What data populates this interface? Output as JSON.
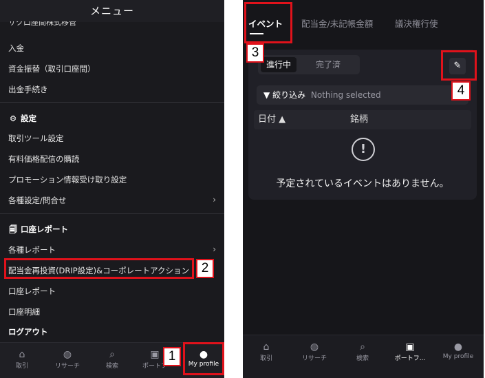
{
  "left": {
    "header_title": "メニュー",
    "cut_row": "サク口座間株式移管",
    "items": [
      {
        "label": "入金"
      },
      {
        "label": "資金振替（取引口座間）"
      },
      {
        "label": "出金手続き"
      }
    ],
    "settings_section": "設定",
    "settings_icon": "gear-icon",
    "settings_items": [
      {
        "label": "取引ツール設定"
      },
      {
        "label": "有料価格配信の購読"
      },
      {
        "label": "プロモーション情報受け取り設定"
      },
      {
        "label": "各種設定/問合せ",
        "chevron": "›"
      }
    ],
    "report_section": "口座レポート",
    "report_icon": "document-icon",
    "report_items": [
      {
        "label": "各種レポート",
        "chevron": "›"
      },
      {
        "label": "配当金再投資(DRIP設定)&コーポレートアクション"
      },
      {
        "label": "口座レポート"
      },
      {
        "label": "口座明細"
      }
    ],
    "logout": "ログアウト",
    "tabbar": [
      {
        "label": "取引",
        "icon": "house-icon"
      },
      {
        "label": "リサーチ",
        "icon": "globe-icon"
      },
      {
        "label": "検索",
        "icon": "search-icon"
      },
      {
        "label": "ポートフ",
        "icon": "briefcase-icon"
      },
      {
        "label": "My profile",
        "icon": "person-icon"
      }
    ]
  },
  "right": {
    "tabs": [
      {
        "label": "イベント"
      },
      {
        "label": "配当金/未記帳金額"
      },
      {
        "label": "議決権行使"
      }
    ],
    "segment": {
      "active": "進行中",
      "inactive": "完了済"
    },
    "filter_label": "絞り込み",
    "filter_placeholder": "Nothing selected",
    "table_headers": {
      "date": "日付 ▲",
      "symbol": "銘柄"
    },
    "empty_message": "予定されているイベントはありません。",
    "tabbar": [
      {
        "label": "取引",
        "icon": "house-icon"
      },
      {
        "label": "リサーチ",
        "icon": "globe-icon"
      },
      {
        "label": "検索",
        "icon": "search-icon"
      },
      {
        "label": "ポートフ...",
        "icon": "briefcase-icon"
      },
      {
        "label": "My profile",
        "icon": "person-icon"
      }
    ]
  },
  "annotations": {
    "n1": "1",
    "n2": "2",
    "n3": "3",
    "n4": "4",
    "color": "#e0121b"
  }
}
